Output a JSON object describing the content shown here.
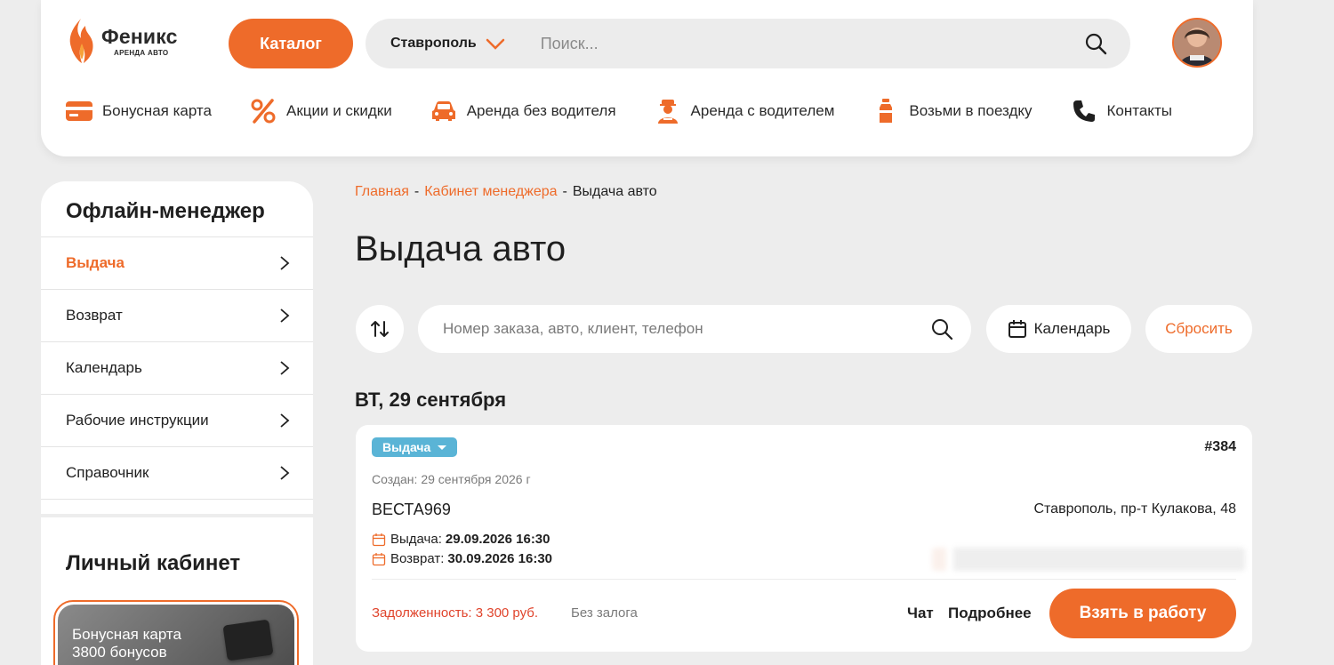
{
  "header": {
    "logo_name": "Феникс",
    "logo_sub": "АРЕНДА АВТО",
    "catalog_label": "Каталог",
    "city": "Ставрополь",
    "search_placeholder": "Поиск...",
    "nav": [
      {
        "label": "Бонусная карта",
        "icon": "card-icon"
      },
      {
        "label": "Акции и скидки",
        "icon": "percent-icon"
      },
      {
        "label": "Аренда без водителя",
        "icon": "car-icon"
      },
      {
        "label": "Аренда с водителем",
        "icon": "driver-icon"
      },
      {
        "label": "Возьми в поездку",
        "icon": "bottle-icon"
      },
      {
        "label": "Контакты",
        "icon": "phone-icon"
      }
    ]
  },
  "sidebar": {
    "title": "Офлайн-менеджер",
    "items": [
      {
        "label": "Выдача",
        "active": true
      },
      {
        "label": "Возврат",
        "active": false
      },
      {
        "label": "Календарь",
        "active": false
      },
      {
        "label": "Рабочие инструкции",
        "active": false
      },
      {
        "label": "Справочник",
        "active": false
      }
    ],
    "title2": "Личный кабинет",
    "bonus_line1": "Бонусная карта",
    "bonus_line2": "3800 бонусов"
  },
  "breadcrumb": {
    "home": "Главная",
    "sep": "-",
    "cabinet": "Кабинет менеджера",
    "current": "Выдача авто"
  },
  "page_title": "Выдача авто",
  "filters": {
    "search_placeholder": "Номер заказа, авто, клиент, телефон",
    "calendar_label": "Календарь",
    "reset_label": "Сбросить"
  },
  "date_heading": "ВТ, 29 сентября",
  "order": {
    "status": "Выдача",
    "number": "#384",
    "created": "Создан: 29 сентября 2026 г",
    "car": "ВЕСТА969",
    "address": "Ставрополь, пр-т Кулакова, 48",
    "issue_label": "Выдача:",
    "issue_value": "29.09.2026 16:30",
    "return_label": "Возврат:",
    "return_value": "30.09.2026 16:30",
    "debt": "Задолженность: 3 300 руб.",
    "deposit": "Без залога",
    "chat_label": "Чат",
    "more_label": "Подробнее",
    "take_label": "Взять в работу"
  },
  "colors": {
    "accent": "#ee6b2a",
    "badge": "#5ab4d6",
    "debt": "#e0442c",
    "background": "#ededed"
  }
}
